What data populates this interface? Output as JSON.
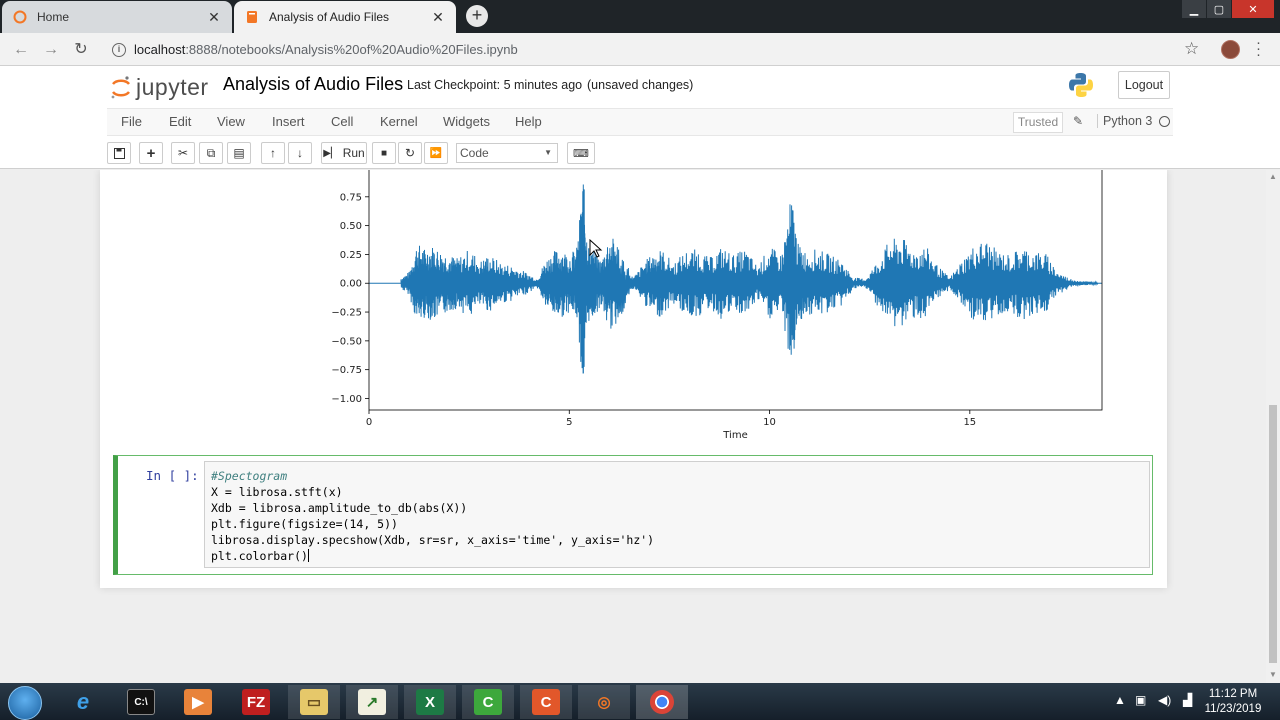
{
  "browser": {
    "tabs": [
      {
        "label": "Home",
        "active": false
      },
      {
        "label": "Analysis of Audio Files",
        "active": true
      }
    ],
    "new_tab": "+",
    "url_host": "localhost",
    "url_rest": ":8888/notebooks/Analysis%20of%20Audio%20Files.ipynb"
  },
  "jupyter": {
    "logo_text": "jupyter",
    "notebook_name": "Analysis of Audio Files",
    "checkpoint": "Last Checkpoint: 5 minutes ago",
    "unsaved": "(unsaved changes)",
    "logout": "Logout",
    "menu": [
      "File",
      "Edit",
      "View",
      "Insert",
      "Cell",
      "Kernel",
      "Widgets",
      "Help"
    ],
    "trusted": "Trusted",
    "kernel": "Python 3",
    "toolbar": {
      "run_label": "Run",
      "cell_type": "Code"
    }
  },
  "plot": {
    "xlabel": "Time",
    "yticks": [
      "0.75",
      "0.50",
      "0.25",
      "0.00",
      "−0.25",
      "−0.50",
      "−0.75",
      "−1.00"
    ],
    "xticks": [
      "0",
      "5",
      "10",
      "15"
    ],
    "color": "#1f77b4"
  },
  "chart_data": {
    "type": "line",
    "title": "",
    "xlabel": "Time",
    "ylabel": "",
    "xlim": [
      0,
      18.3
    ],
    "ylim": [
      -1.1,
      1.0
    ],
    "series": [
      {
        "x": [
          0.8,
          1.0,
          1.2,
          1.4,
          1.6,
          1.8,
          2.0,
          2.2,
          2.5,
          2.8,
          3.0,
          3.3,
          3.6,
          3.9,
          4.2,
          4.4,
          4.6,
          4.8,
          5.0,
          5.2,
          5.35,
          5.45,
          5.6,
          5.8,
          6.0,
          6.2,
          6.6,
          6.9,
          7.1,
          7.3,
          7.6,
          7.9,
          8.2,
          8.5,
          8.8,
          9.1,
          9.4,
          9.7,
          10.0,
          10.3,
          10.55,
          10.7,
          10.9,
          11.2,
          11.5,
          11.8,
          12.1,
          12.4,
          12.7,
          13.0,
          13.3,
          13.6,
          13.9,
          14.2,
          14.5,
          14.8,
          15.1,
          15.4,
          15.7,
          16.0,
          16.3,
          16.6,
          16.9,
          17.2,
          17.5,
          17.8,
          18.2
        ],
        "y": [
          0.05,
          0.1,
          0.35,
          0.3,
          0.33,
          0.28,
          0.25,
          0.22,
          0.3,
          0.2,
          0.25,
          0.18,
          0.15,
          0.1,
          0.04,
          0.2,
          0.28,
          0.3,
          0.25,
          0.32,
          0.96,
          0.35,
          0.3,
          0.2,
          0.42,
          0.36,
          0.05,
          0.2,
          0.26,
          0.3,
          0.18,
          0.28,
          0.3,
          0.22,
          0.32,
          0.25,
          0.3,
          0.15,
          0.32,
          0.25,
          0.78,
          0.35,
          0.28,
          0.3,
          0.25,
          0.2,
          0.05,
          0.04,
          0.2,
          0.38,
          0.4,
          0.3,
          0.33,
          0.15,
          0.05,
          0.2,
          0.33,
          0.38,
          0.28,
          0.25,
          0.32,
          0.28,
          0.26,
          0.1,
          0.04,
          0.02,
          0.01
        ]
      }
    ],
    "note_symmetric": true
  },
  "code_cell": {
    "prompt": "In [ ]:",
    "lines": [
      "#Spectogram",
      "X = librosa.stft(x)",
      "Xdb = librosa.amplitude_to_db(abs(X))",
      "plt.figure(figsize=(14, 5))",
      "librosa.display.specshow(Xdb, sr=sr, x_axis='time', y_axis='hz')",
      "plt.colorbar()"
    ]
  },
  "taskbar": {
    "time": "11:12 PM",
    "date": "11/23/2019"
  }
}
